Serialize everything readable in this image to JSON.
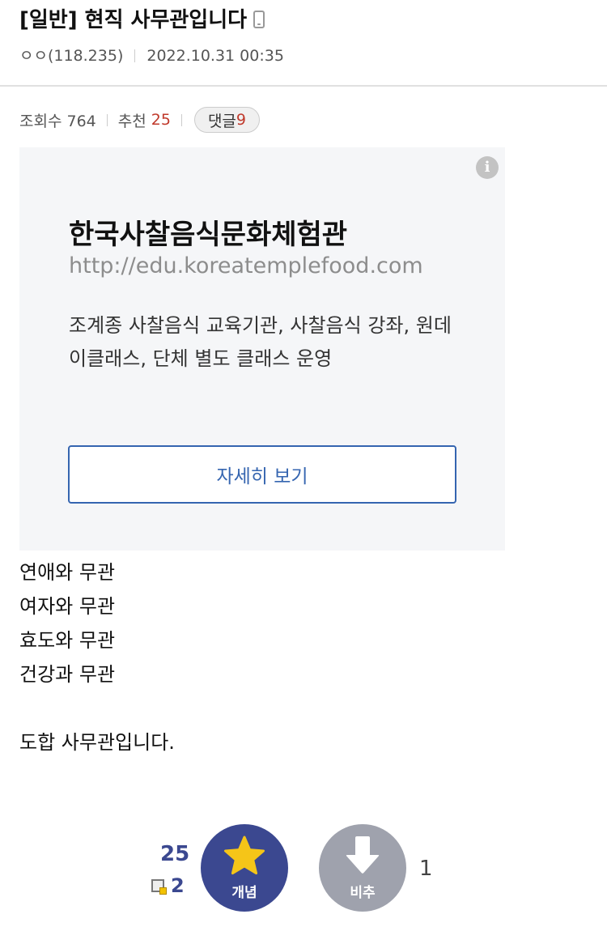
{
  "post": {
    "title": "[일반] 현직 사무관입니다",
    "author": "ㅇㅇ(118.235)",
    "date": "2022.10.31 00:35"
  },
  "stats": {
    "views_label": "조회수 764",
    "recommend_label": "추천",
    "recommend_count": "25",
    "comment_label": "댓글",
    "comment_count": "9"
  },
  "ad": {
    "title": "한국사찰음식문화체험관",
    "url": "http://edu.koreatemplefood.com",
    "description": "조계종 사찰음식 교육기관, 사찰음식 강좌, 원데이클래스, 단체 별도 클래스 운영",
    "button_label": "자세히 보기",
    "info_icon": "i"
  },
  "body": {
    "lines": [
      "연애와 무관",
      "여자와 무관",
      "효도와 무관",
      "건강과 무관",
      "",
      "도합 사무관입니다."
    ]
  },
  "vote": {
    "up_count": "25",
    "fixed_count": "2",
    "up_label": "개념",
    "down_label": "비추",
    "down_count": "1"
  },
  "colors": {
    "accent_up": "#3b4890",
    "accent_down": "#9fa2ad",
    "recommend_red": "#c0392b",
    "ad_button": "#3565b0"
  },
  "icons": [
    "mobile-icon",
    "info-icon",
    "star-icon",
    "down-arrow-icon",
    "fixed-recommend-icon"
  ]
}
